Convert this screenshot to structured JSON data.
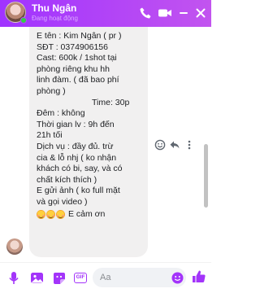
{
  "header": {
    "contact_name": "Thu Ngân",
    "status": "Đang hoạt động",
    "accent_color": "#a334fa",
    "icons": [
      "phone-icon",
      "video-icon",
      "minimize-icon",
      "close-icon"
    ]
  },
  "message": {
    "lines": [
      "E tên : Kim Ngân  ( pr  )",
      "SĐT : 0374906156",
      "Cast: 600k / 1shot tại",
      "phòng riêng khu hh",
      "linh đàm. ( đã bao phí",
      "phòng )",
      "Time: 30p",
      "Đêm : không",
      "Thời gian lv : 9h đến",
      "21h tối",
      "Dịch vụ : đầy đủ. trừ",
      "cia & lỗ nhj ( ko nhận",
      "khách có bi, say, và có",
      "chất kích thích )",
      "E gửi ảnh ( ko full mặt",
      "và gọi video )"
    ],
    "closing_text": "E cảm ơn",
    "emoji": "smiling-face-icon"
  },
  "message_actions": [
    "react-icon",
    "reply-icon",
    "more-icon"
  ],
  "composer": {
    "placeholder": "Aa",
    "icons": [
      "mic-icon",
      "image-icon",
      "sticker-icon",
      "gif-icon",
      "emoji-icon",
      "like-icon"
    ],
    "gif_label": "GIF"
  }
}
